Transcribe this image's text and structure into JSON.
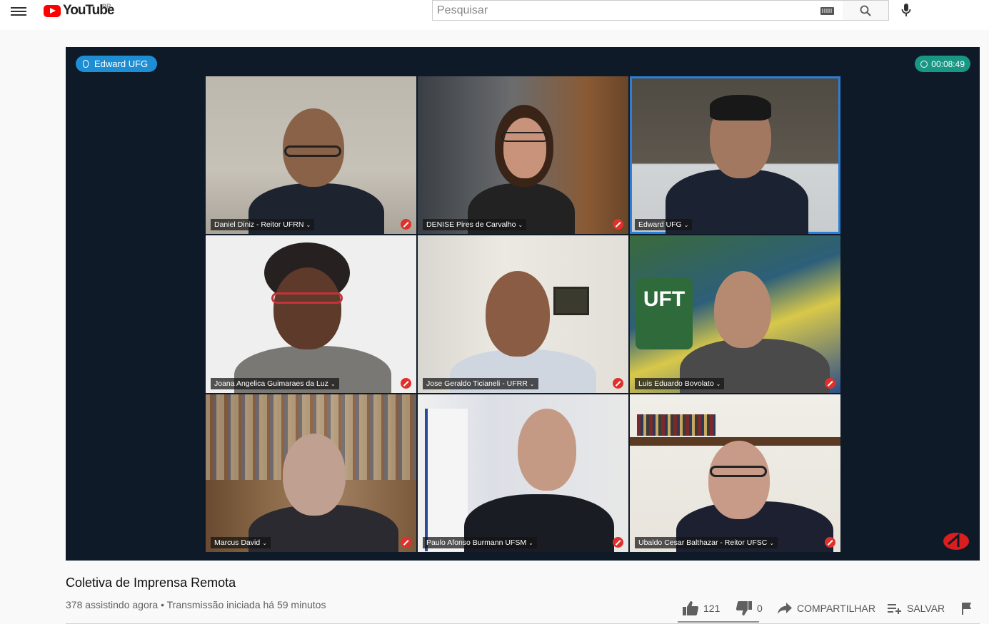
{
  "header": {
    "logo_text": "YouTube",
    "region": "BR",
    "search_placeholder": "Pesquisar"
  },
  "player": {
    "active_speaker": "Edward UFG",
    "elapsed": "00:08:49",
    "participants": [
      {
        "name": "Daniel Diniz - Reitor UFRN",
        "muted": true
      },
      {
        "name": "DENISE Pires de Carvalho",
        "muted": true
      },
      {
        "name": "Edward UFG",
        "muted": false,
        "active": true
      },
      {
        "name": "Joana Angelica Guimaraes da Luz",
        "muted": true
      },
      {
        "name": "Jose Geraldo Ticianeli - UFRR",
        "muted": true
      },
      {
        "name": "Luis Eduardo Bovolato",
        "muted": true
      },
      {
        "name": "Marcus David",
        "muted": true
      },
      {
        "name": "Paulo Afonso Burmann UFSM",
        "muted": true
      },
      {
        "name": "Ubaldo Cesar Balthazar - Reitor UFSC",
        "muted": true
      }
    ],
    "uft_sign": "UFT"
  },
  "video": {
    "title": "Coletiva de Imprensa Remota",
    "meta": "378 assistindo agora • Transmissão iniciada há 59 minutos",
    "likes": "121",
    "dislikes": "0",
    "share_label": "COMPARTILHAR",
    "save_label": "SALVAR"
  }
}
